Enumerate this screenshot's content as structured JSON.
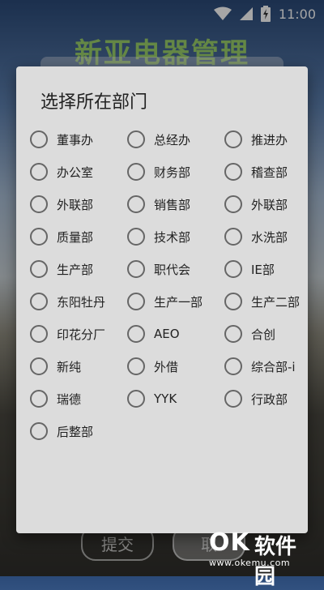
{
  "status_bar": {
    "time": "11:00",
    "icons": [
      "wifi-icon",
      "signal-icon",
      "battery-charging-icon"
    ]
  },
  "background_app": {
    "title": "新亚电器管理",
    "submit_label": "提交",
    "login_label": "取"
  },
  "dialog": {
    "title": "选择所在部门",
    "options": [
      "董事办",
      "总经办",
      "推进办",
      "办公室",
      "财务部",
      "稽查部",
      "外联部",
      "销售部",
      "外联部",
      "质量部",
      "技术部",
      "水洗部",
      "生产部",
      "职代会",
      "IE部",
      "东阳牡丹",
      "生产一部",
      "生产二部",
      "印花分厂",
      "AEO",
      "合创",
      "新纯",
      "外借",
      "综合部-i",
      "瑞德",
      "YYK",
      "行政部",
      "后整部"
    ]
  },
  "watermark": {
    "logo": "OK",
    "brand": "软件园",
    "url": "www.okemu.com"
  },
  "colors": {
    "dialog_bg": "#dcdcdc",
    "radio_border": "#666666",
    "text": "#222222"
  }
}
